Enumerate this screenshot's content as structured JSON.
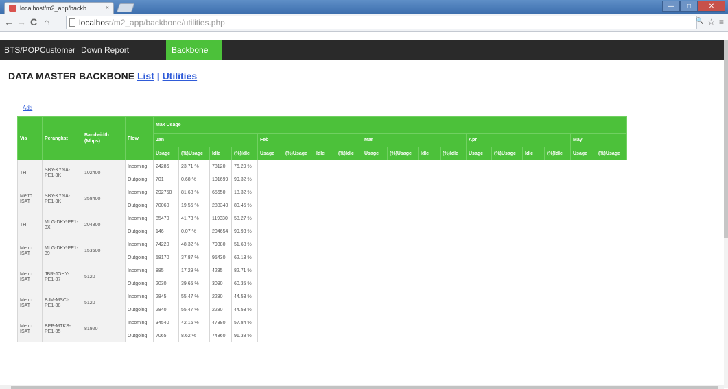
{
  "browser": {
    "tab_title": "localhost/m2_app/backb",
    "tab_close": "×",
    "url_host": "localhost",
    "url_path": "/m2_app/backbone/utilities.php",
    "nav_back": "←",
    "nav_forward": "→",
    "nav_reload": "C",
    "nav_home": "⌂",
    "zoom_icon": "🔍",
    "star_icon": "☆",
    "menu_icon": "≡",
    "win_min": "—",
    "win_max": "□",
    "win_close": "✕"
  },
  "appnav": {
    "items": [
      {
        "label": "BTS/POP",
        "active": false
      },
      {
        "label": "Customer",
        "active": false
      },
      {
        "label": "Down Report",
        "active": false
      },
      {
        "label": "Backbone",
        "active": true
      }
    ]
  },
  "page": {
    "title": "DATA MASTER BACKBONE",
    "link_list": "List",
    "separator": "|",
    "link_utilities": "Utilities",
    "add_link": "Add"
  },
  "table": {
    "headers": {
      "via": "Via",
      "perangkat": "Perangkat",
      "bandwidth": "Bandwidth (Mbps)",
      "flow": "Flow",
      "max_usage": "Max Usage",
      "months": [
        "Jan",
        "Feb",
        "Mar",
        "Apr",
        "May"
      ],
      "subcols": [
        "Usage",
        "(%)Usage",
        "Idle",
        "(%)Idle"
      ]
    },
    "accent": "#4cc13a",
    "rows": [
      {
        "via": "TH",
        "perangkat": "SBY-KYNA-PE1-3K",
        "bandwidth": "102400",
        "flows": [
          {
            "flow": "Incoming",
            "usage": "24286",
            "pct_usage": "23.71 %",
            "idle": "78120",
            "pct_idle": "76.29 %"
          },
          {
            "flow": "Outgoing",
            "usage": "701",
            "pct_usage": "0.68 %",
            "idle": "101699",
            "pct_idle": "99.32 %"
          }
        ]
      },
      {
        "via": "Metro ISAT",
        "perangkat": "SBY-KYNA-PE1-3K",
        "bandwidth": "358400",
        "flows": [
          {
            "flow": "Incoming",
            "usage": "292750",
            "pct_usage": "81.68 %",
            "idle": "65650",
            "pct_idle": "18.32 %"
          },
          {
            "flow": "Outgoing",
            "usage": "70060",
            "pct_usage": "19.55 %",
            "idle": "288340",
            "pct_idle": "80.45 %"
          }
        ]
      },
      {
        "via": "TH",
        "perangkat": "MLG-DKY-PE1-3X",
        "bandwidth": "204800",
        "flows": [
          {
            "flow": "Incoming",
            "usage": "85470",
            "pct_usage": "41.73 %",
            "idle": "119330",
            "pct_idle": "58.27 %"
          },
          {
            "flow": "Outgoing",
            "usage": "146",
            "pct_usage": "0.07 %",
            "idle": "204654",
            "pct_idle": "99.93 %"
          }
        ]
      },
      {
        "via": "Metro ISAT",
        "perangkat": "MLG-DKY-PE1-39",
        "bandwidth": "153600",
        "flows": [
          {
            "flow": "Incoming",
            "usage": "74220",
            "pct_usage": "48.32 %",
            "idle": "79380",
            "pct_idle": "51.68 %"
          },
          {
            "flow": "Outgoing",
            "usage": "58170",
            "pct_usage": "37.87 %",
            "idle": "95430",
            "pct_idle": "62.13 %"
          }
        ]
      },
      {
        "via": "Metro ISAT",
        "perangkat": "JBR-JOHY-PE1-37",
        "bandwidth": "5120",
        "flows": [
          {
            "flow": "Incoming",
            "usage": "885",
            "pct_usage": "17.29 %",
            "idle": "4235",
            "pct_idle": "82.71 %"
          },
          {
            "flow": "Outgoing",
            "usage": "2030",
            "pct_usage": "39.65 %",
            "idle": "3090",
            "pct_idle": "60.35 %"
          }
        ]
      },
      {
        "via": "Metro ISAT",
        "perangkat": "BJM-MSCI-PE1-38",
        "bandwidth": "5120",
        "flows": [
          {
            "flow": "Incoming",
            "usage": "2845",
            "pct_usage": "55.47 %",
            "idle": "2280",
            "pct_idle": "44.53 %"
          },
          {
            "flow": "Outgoing",
            "usage": "2840",
            "pct_usage": "55.47 %",
            "idle": "2280",
            "pct_idle": "44.53 %"
          }
        ]
      },
      {
        "via": "Metro ISAT",
        "perangkat": "BPP-MTKS-PE1-35",
        "bandwidth": "81920",
        "flows": [
          {
            "flow": "Incoming",
            "usage": "34540",
            "pct_usage": "42.16 %",
            "idle": "47380",
            "pct_idle": "57.84 %"
          },
          {
            "flow": "Outgoing",
            "usage": "7065",
            "pct_usage": "8.62 %",
            "idle": "74860",
            "pct_idle": "91.38 %"
          }
        ]
      }
    ]
  }
}
